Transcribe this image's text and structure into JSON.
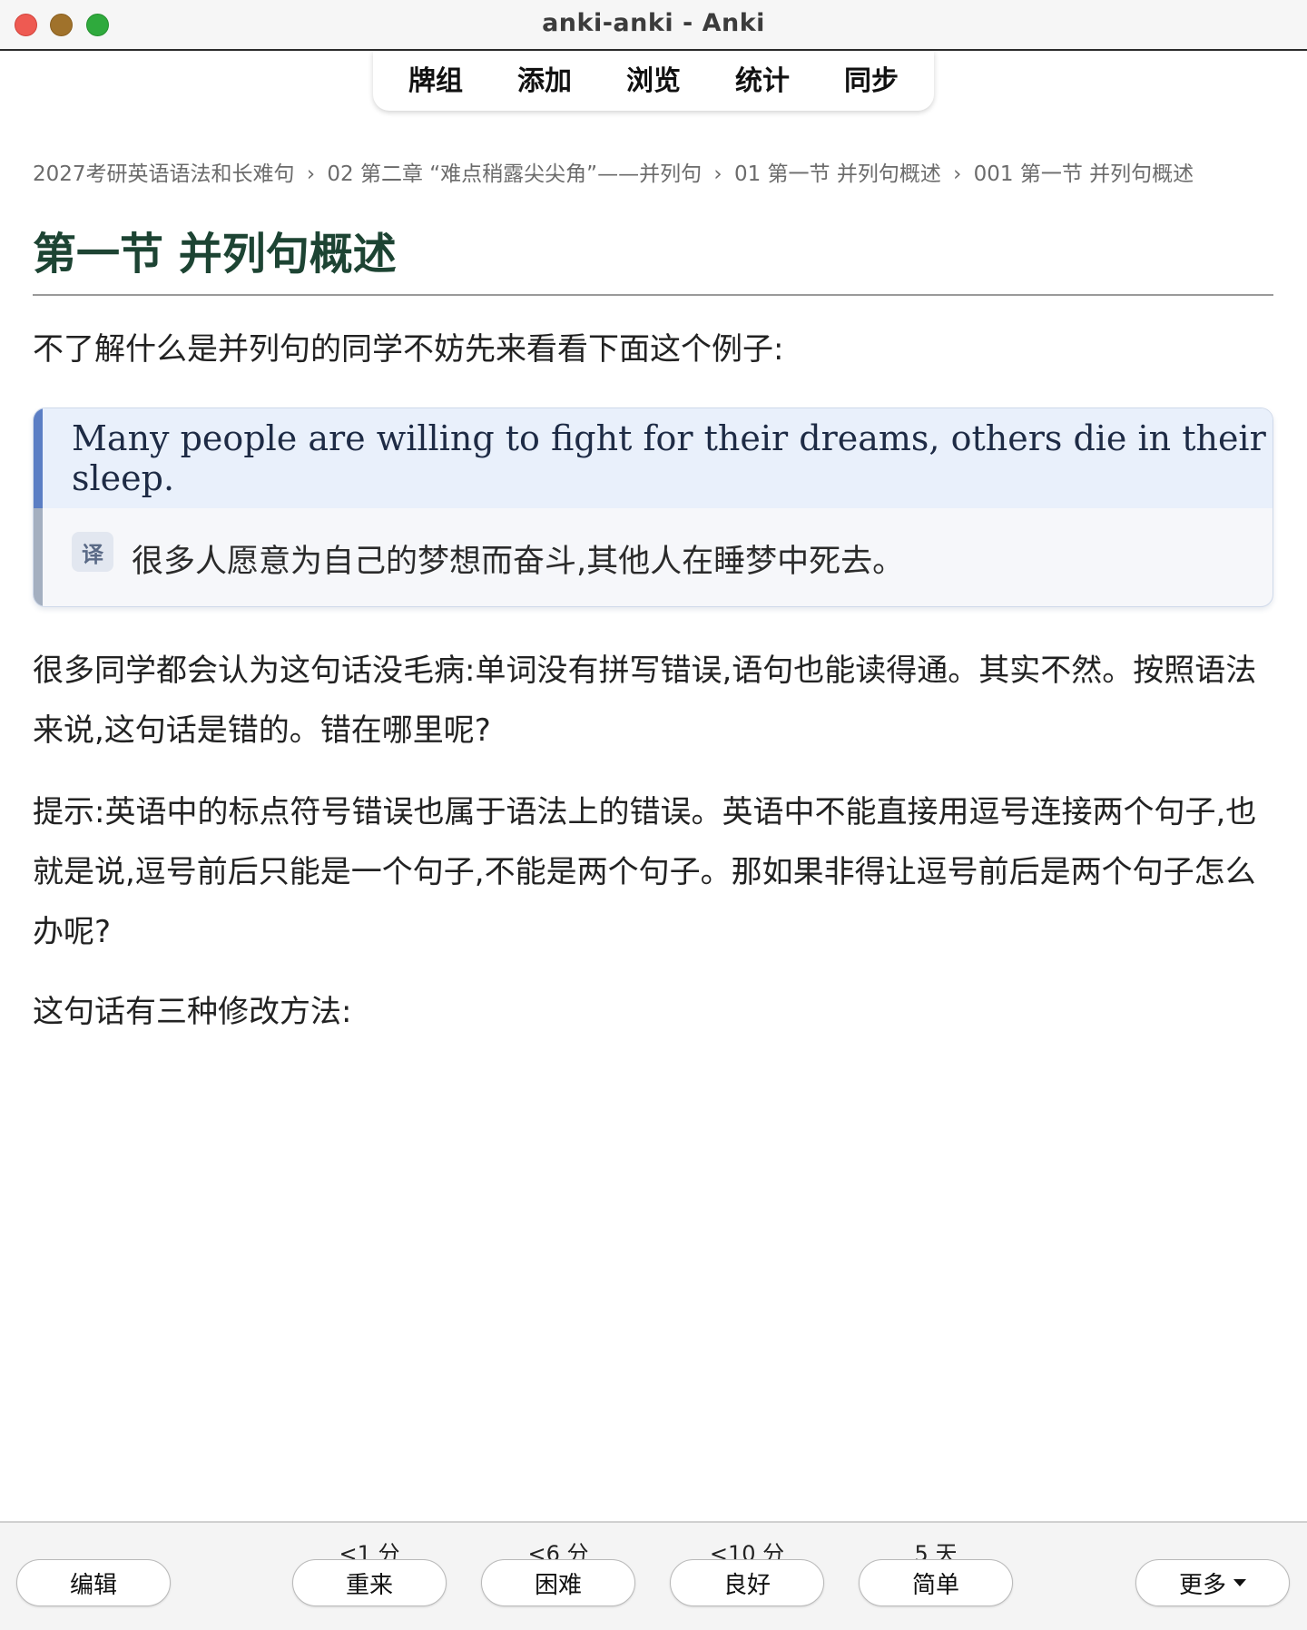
{
  "window": {
    "title": "anki-anki - Anki"
  },
  "toolbar": {
    "items": [
      "牌组",
      "添加",
      "浏览",
      "统计",
      "同步"
    ]
  },
  "breadcrumb": [
    "2027考研英语语法和长难句",
    "02 第二章 “难点稍露尖尖角”——并列句",
    "01 第一节 并列句概述",
    "001 第一节 并列句概述"
  ],
  "breadcrumb_sep": "›",
  "content": {
    "title": "第一节 并列句概述",
    "intro": "不了解什么是并列句的同学不妨先来看看下面这个例子:",
    "example": {
      "english": "Many people are willing to fight for their dreams, others die in their sleep.",
      "badge": "译",
      "translation": "很多人愿意为自己的梦想而奋斗,其他人在睡梦中死去。"
    },
    "para1": "很多同学都会认为这句话没毛病:单词没有拼写错误,语句也能读得通。其实不然。按照语法来说,这句话是错的。错在哪里呢?",
    "para2": "提示:英语中的标点符号错误也属于语法上的错误。英语中不能直接用逗号连接两个句子,也就是说,逗号前后只能是一个句子,不能是两个句子。那如果非得让逗号前后是两个句子怎么办呢?",
    "para3": "这句话有三种修改方法:"
  },
  "bottom": {
    "edit": "编辑",
    "answers": [
      {
        "interval": "<1 分",
        "label": "重来"
      },
      {
        "interval": "<6 分",
        "label": "困难"
      },
      {
        "interval": "<10 分",
        "label": "良好"
      },
      {
        "interval": "5 天",
        "label": "简单"
      }
    ],
    "more": "更多"
  },
  "colors": {
    "title": "#1d4433",
    "accent": "#5b7ec4",
    "example_bg": "#e9f0fb"
  }
}
